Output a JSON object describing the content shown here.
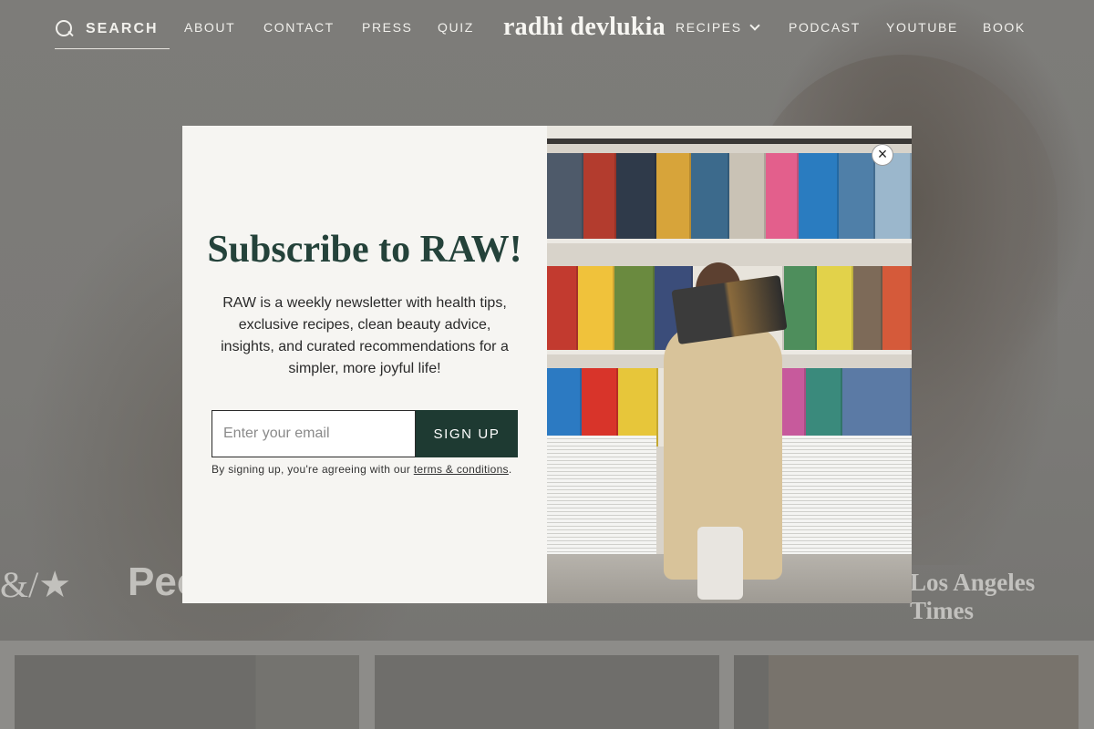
{
  "nav": {
    "search_label": "SEARCH",
    "links": [
      "ABOUT",
      "CONTACT",
      "PRESS",
      "QUIZ"
    ],
    "brand": "radhi devlukia",
    "right_links": [
      "RECIPES",
      "PODCAST",
      "YOUTUBE",
      "BOOK"
    ]
  },
  "press_logos": [
    "Los Angeles Times"
  ],
  "modal": {
    "title": "Subscribe to RAW!",
    "description": "RAW is a weekly newsletter with health tips, exclusive recipes, clean beauty advice, insights, and curated recommendations for a simpler, more joyful life!",
    "email_placeholder": "Enter your email",
    "email_value": "",
    "signup_label": "SIGN UP",
    "disclaimer_prefix": "By signing up, you're agreeing with our ",
    "terms_link": "terms & conditions",
    "disclaimer_suffix": ".",
    "close_icon": "×"
  },
  "colors": {
    "accent": "#1e3a32",
    "title": "#24423a",
    "modal_bg": "#f6f5f2",
    "overlay": "#7a7a78"
  }
}
